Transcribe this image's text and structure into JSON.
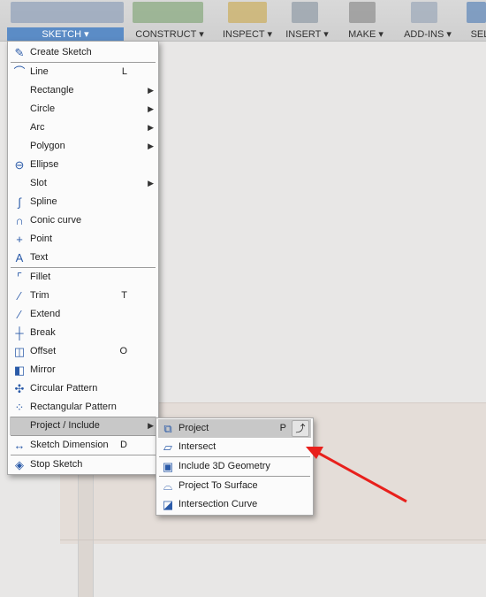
{
  "toolbar": {
    "groups": [
      {
        "label": "SKETCH ▾",
        "active": true
      },
      {
        "label": "CONSTRUCT ▾"
      },
      {
        "label": "INSPECT ▾"
      },
      {
        "label": "INSERT ▾"
      },
      {
        "label": "MAKE ▾"
      },
      {
        "label": "ADD-INS ▾"
      },
      {
        "label": "SEL"
      }
    ]
  },
  "sketch_menu": {
    "items": [
      {
        "label": "Create Sketch",
        "icon": "create-sketch-icon",
        "glyph": "✎"
      },
      {
        "label": "Line",
        "icon": "line-icon",
        "glyph": "⌒",
        "shortcut": "L"
      },
      {
        "label": "Rectangle",
        "submenu": true
      },
      {
        "label": "Circle",
        "submenu": true
      },
      {
        "label": "Arc",
        "submenu": true
      },
      {
        "label": "Polygon",
        "submenu": true
      },
      {
        "label": "Ellipse",
        "icon": "ellipse-icon",
        "glyph": "⊖"
      },
      {
        "label": "Slot",
        "submenu": true
      },
      {
        "label": "Spline",
        "icon": "spline-icon",
        "glyph": "∫"
      },
      {
        "label": "Conic curve",
        "icon": "conic-curve-icon",
        "glyph": "∩"
      },
      {
        "label": "Point",
        "icon": "point-icon",
        "glyph": "+"
      },
      {
        "label": "Text",
        "icon": "text-icon",
        "glyph": "A"
      },
      {
        "label": "Fillet",
        "icon": "fillet-icon",
        "glyph": "⌜"
      },
      {
        "label": "Trim",
        "icon": "trim-icon",
        "glyph": "⁄",
        "shortcut": "T"
      },
      {
        "label": "Extend",
        "icon": "extend-icon",
        "glyph": "⁄"
      },
      {
        "label": "Break",
        "icon": "break-icon",
        "glyph": "┼"
      },
      {
        "label": "Offset",
        "icon": "offset-icon",
        "glyph": "◫",
        "shortcut": "O"
      },
      {
        "label": "Mirror",
        "icon": "mirror-icon",
        "glyph": "◧"
      },
      {
        "label": "Circular Pattern",
        "icon": "circular-pattern-icon",
        "glyph": "✣"
      },
      {
        "label": "Rectangular Pattern",
        "icon": "rectangular-pattern-icon",
        "glyph": "⁘"
      },
      {
        "label": "Project / Include",
        "submenu": true,
        "highlighted": true
      },
      {
        "label": "Sketch Dimension",
        "icon": "sketch-dimension-icon",
        "glyph": "↔",
        "shortcut": "D"
      },
      {
        "label": "Stop Sketch",
        "icon": "stop-sketch-icon",
        "glyph": "◈"
      }
    ]
  },
  "project_submenu": {
    "items": [
      {
        "label": "Project",
        "icon": "project-icon",
        "glyph": "⧉",
        "shortcut": "P",
        "highlighted": true
      },
      {
        "label": "Intersect",
        "icon": "intersect-icon",
        "glyph": "▱"
      },
      {
        "label": "Include 3D Geometry",
        "icon": "include-3d-geometry-icon",
        "glyph": "▣"
      },
      {
        "label": "Project To Surface",
        "icon": "project-to-surface-icon",
        "glyph": "⌓"
      },
      {
        "label": "Intersection Curve",
        "icon": "intersection-curve-icon",
        "glyph": "◪"
      }
    ]
  },
  "colors": {
    "accent": "#5b8cc6",
    "highlight": "#c8c8c8",
    "annotation_arrow": "#e8201c"
  }
}
